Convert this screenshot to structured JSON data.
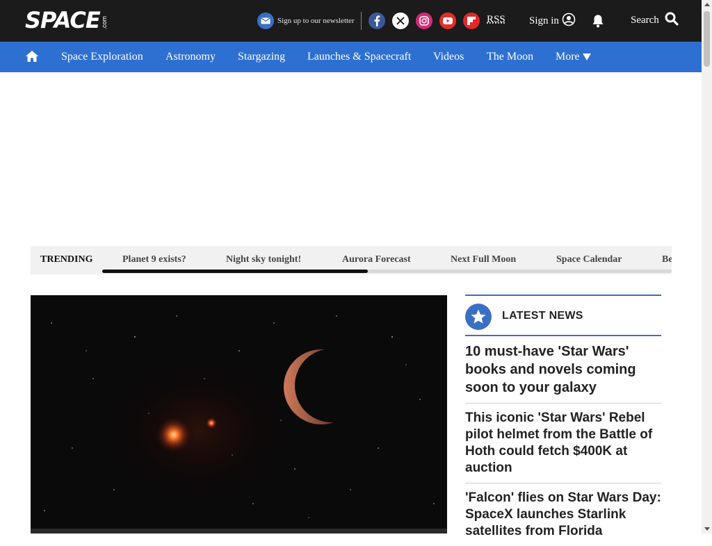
{
  "header": {
    "logo_main": "SPACE",
    "logo_suffix": ".com",
    "newsletter_label": "Sign up to our newsletter",
    "rss_label": "RSS",
    "signin_label": "Sign in",
    "search_label": "Search"
  },
  "social": [
    {
      "name": "facebook-icon",
      "color": "#3b5998"
    },
    {
      "name": "x-icon",
      "color": "#ffffff"
    },
    {
      "name": "instagram-icon",
      "color": "#d62976"
    },
    {
      "name": "youtube-icon",
      "color": "#e52d27"
    },
    {
      "name": "flipboard-icon",
      "color": "#e12828"
    }
  ],
  "nav": {
    "items": [
      {
        "label": "Space Exploration"
      },
      {
        "label": "Astronomy"
      },
      {
        "label": "Stargazing"
      },
      {
        "label": "Launches & Spacecraft"
      },
      {
        "label": "Videos"
      },
      {
        "label": "The Moon"
      },
      {
        "label": "More"
      }
    ]
  },
  "trending": {
    "label": "TRENDING",
    "items": [
      {
        "label": "Planet 9 exists?"
      },
      {
        "label": "Night sky tonight!"
      },
      {
        "label": "Aurora Forecast"
      },
      {
        "label": "Next Full Moon"
      },
      {
        "label": "Space Calendar"
      },
      {
        "label": "Be"
      }
    ]
  },
  "latest_news": {
    "title": "LATEST NEWS",
    "items": [
      {
        "headline": "10 must-have 'Star Wars' books and novels coming soon to your galaxy"
      },
      {
        "headline": "This iconic 'Star Wars' Rebel pilot helmet from the Battle of Hoth could fetch $400K at auction"
      },
      {
        "headline": "'Falcon' flies on Star Wars Day: SpaceX launches Starlink satellites from Florida"
      }
    ]
  },
  "colors": {
    "nav_bg": "#2e6fd2",
    "header_bg": "#1b1b1b",
    "accent": "#3a6fc4"
  }
}
